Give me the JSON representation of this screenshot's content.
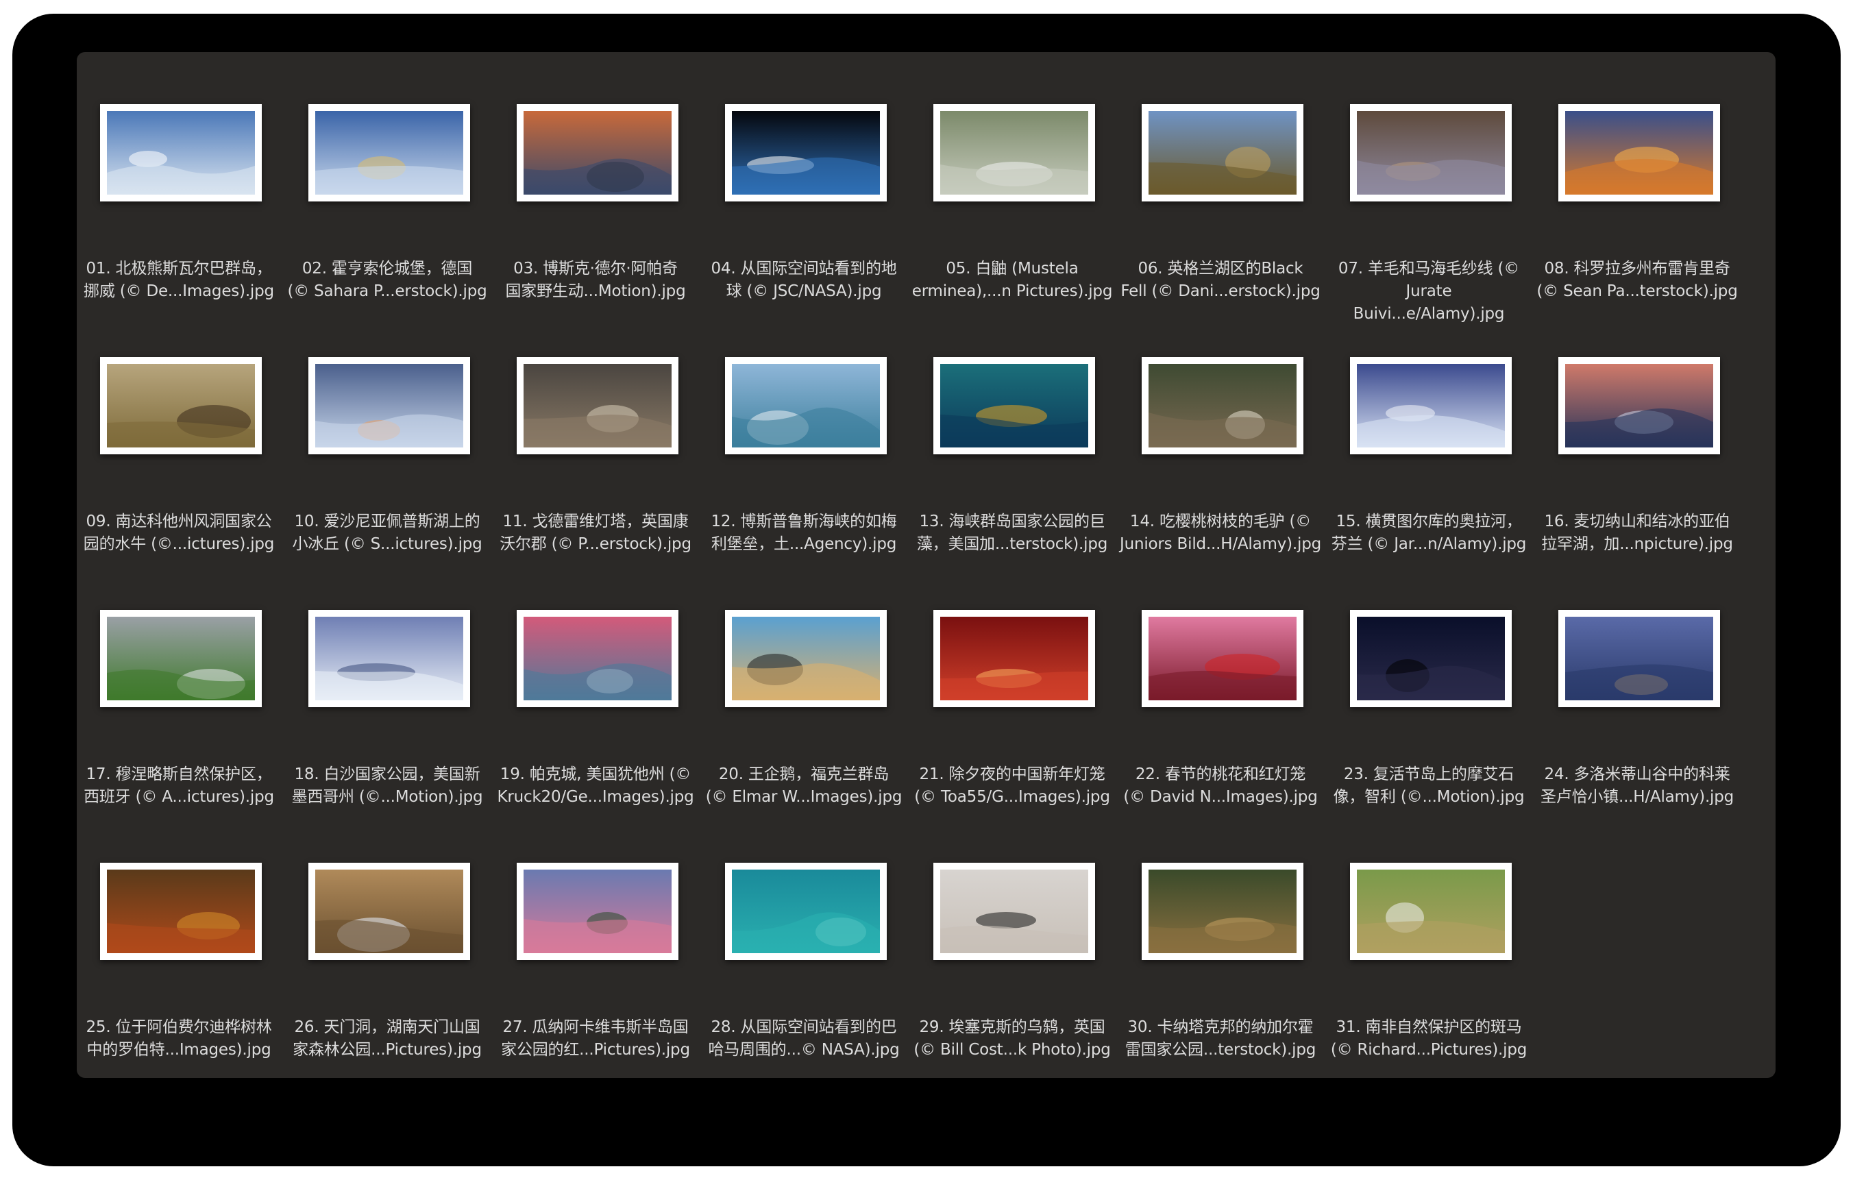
{
  "files": [
    {
      "name": "01. 北极熊斯瓦尔巴群岛，\n挪威 (© De...Images).jpg",
      "thumb": {
        "top": "#4b78b8",
        "bottom": "#d9e4f0",
        "accent": "#ffffff"
      }
    },
    {
      "name": "02. 霍亨索伦城堡，德国\n(© Sahara P...erstock).jpg",
      "thumb": {
        "top": "#3a64a8",
        "bottom": "#c9d8ec",
        "accent": "#e0c06a"
      }
    },
    {
      "name": "03. 博斯克·德尔·阿帕奇\n国家野生动...Motion).jpg",
      "thumb": {
        "top": "#c8693a",
        "bottom": "#3b4a6b",
        "accent": "#1d1d1d"
      }
    },
    {
      "name": "04. 从国际空间站看到的地\n球 (© JSC/NASA).jpg",
      "thumb": {
        "top": "#05070d",
        "bottom": "#2f6fb5",
        "accent": "#ffffff"
      }
    },
    {
      "name": "05. 白鼬 (Mustela\nerminea),...n Pictures).jpg",
      "thumb": {
        "top": "#7c8a6a",
        "bottom": "#c7ccbe",
        "accent": "#f2f2f2"
      }
    },
    {
      "name": "06. 英格兰湖区的Black\nFell (© Dani...erstock).jpg",
      "thumb": {
        "top": "#6f93c4",
        "bottom": "#6b5a2c",
        "accent": "#c4a35a"
      }
    },
    {
      "name": "07. 羊毛和马海毛纱线 (©\nJurate Buivi...e/Alamy).jpg",
      "thumb": {
        "top": "#5e4a3c",
        "bottom": "#8f8aa0",
        "accent": "#b89b80"
      }
    },
    {
      "name": "08. 科罗拉多州布雷肯里奇\n(© Sean Pa...terstock).jpg",
      "thumb": {
        "top": "#3a4f8a",
        "bottom": "#d77a2c",
        "accent": "#ffb347"
      }
    },
    {
      "name": "09. 南达科他州风洞国家公\n园的水牛 (©...ictures).jpg",
      "thumb": {
        "top": "#b7a57d",
        "bottom": "#7e6b3a",
        "accent": "#3b2a1a"
      }
    },
    {
      "name": "10. 爱沙尼亚佩普斯湖上的\n小冰丘 (© S...ictures).jpg",
      "thumb": {
        "top": "#4a5f8c",
        "bottom": "#c8d6ea",
        "accent": "#f0a060"
      }
    },
    {
      "name": "11. 戈德雷维灯塔，英国康\n沃尔郡 (© P...erstock).jpg",
      "thumb": {
        "top": "#4a4540",
        "bottom": "#8a7a66",
        "accent": "#d8cdb8"
      }
    },
    {
      "name": "12. 博斯普鲁斯海峡的如梅\n利堡垒，土...Agency).jpg",
      "thumb": {
        "top": "#8fb6d8",
        "bottom": "#3c7f9c",
        "accent": "#e9eef2"
      }
    },
    {
      "name": "13. 海峡群岛国家公园的巨\n藻，美国加...terstock).jpg",
      "thumb": {
        "top": "#1b6f7a",
        "bottom": "#0c3a5a",
        "accent": "#e0a020"
      }
    },
    {
      "name": "14. 吃樱桃树枝的毛驴 (©\nJuniors Bild...H/Alamy).jpg",
      "thumb": {
        "top": "#3e4a32",
        "bottom": "#7a6a52",
        "accent": "#e8e0d0"
      }
    },
    {
      "name": "15. 横贯图尔库的奥拉河，\n芬兰 (© Jar...n/Alamy).jpg",
      "thumb": {
        "top": "#3b4a8e",
        "bottom": "#d8e2f4",
        "accent": "#f2f4fa"
      }
    },
    {
      "name": "16. 麦切纳山和结冰的亚伯\n拉罕湖，加...npicture).jpg",
      "thumb": {
        "top": "#d07a6a",
        "bottom": "#27345a",
        "accent": "#c8d4ea"
      }
    },
    {
      "name": "17. 穆涅略斯自然保护区，\n西班牙 (© A...ictures).jpg",
      "thumb": {
        "top": "#9aa0a6",
        "bottom": "#3f7a2c",
        "accent": "#e8eaec"
      }
    },
    {
      "name": "18. 白沙国家公园，美国新\n墨西哥州 (©...Motion).jpg",
      "thumb": {
        "top": "#6f7fb4",
        "bottom": "#e8eef6",
        "accent": "#3a4a7a"
      }
    },
    {
      "name": "19. 帕克城, 美国犹他州 (©\nKruck20/Ge...Images).jpg",
      "thumb": {
        "top": "#d35a7a",
        "bottom": "#4f7a9a",
        "accent": "#eef2f6"
      }
    },
    {
      "name": "20. 王企鹅，福克兰群岛\n(© Elmar W...Images).jpg",
      "thumb": {
        "top": "#5aa0d0",
        "bottom": "#d8b070",
        "accent": "#1e1e1e"
      }
    },
    {
      "name": "21. 除夕夜的中国新年灯笼\n(© Toa55/G...Images).jpg",
      "thumb": {
        "top": "#7a1010",
        "bottom": "#d0402a",
        "accent": "#ffb060"
      }
    },
    {
      "name": "22. 春节的桃花和红灯笼\n(© David N...Images).jpg",
      "thumb": {
        "top": "#e07aa0",
        "bottom": "#7a1a2a",
        "accent": "#d02020"
      }
    },
    {
      "name": "23. 复活节岛上的摩艾石\n像，智利 (©...Motion).jpg",
      "thumb": {
        "top": "#0a0f2a",
        "bottom": "#2a2a4a",
        "accent": "#000000"
      }
    },
    {
      "name": "24. 多洛米蒂山谷中的科莱\n圣卢恰小镇...H/Alamy).jpg",
      "thumb": {
        "top": "#5a6aa8",
        "bottom": "#2a3a6a",
        "accent": "#f0c070"
      }
    },
    {
      "name": "25. 位于阿伯费尔迪桦树林\n中的罗伯特...Images).jpg",
      "thumb": {
        "top": "#5a3a1a",
        "bottom": "#b04a1a",
        "accent": "#d8902a"
      }
    },
    {
      "name": "26. 天门洞，湖南天门山国\n家森林公园...Pictures).jpg",
      "thumb": {
        "top": "#b08a5a",
        "bottom": "#6a5030",
        "accent": "#e8f0ff"
      }
    },
    {
      "name": "27. 瓜纳阿卡维韦斯半岛国\n家公园的红...Pictures).jpg",
      "thumb": {
        "top": "#6a7ab0",
        "bottom": "#d87a9a",
        "accent": "#2a4a2a"
      }
    },
    {
      "name": "28. 从国际空间站看到的巴\n哈马周围的...© NASA).jpg",
      "thumb": {
        "top": "#1a8a9a",
        "bottom": "#2ab0b0",
        "accent": "#8fe0d8"
      }
    },
    {
      "name": "29. 埃塞克斯的乌鸫，英国\n(© Bill Cost...k Photo).jpg",
      "thumb": {
        "top": "#d8d4d0",
        "bottom": "#c8c0b8",
        "accent": "#1a1a1a"
      }
    },
    {
      "name": "30. 卡纳塔克邦的纳加尔霍\n雷国家公园...terstock).jpg",
      "thumb": {
        "top": "#3a4a2a",
        "bottom": "#8a7040",
        "accent": "#c8a060"
      }
    },
    {
      "name": "31. 南非自然保护区的斑马\n(© Richard...Pictures).jpg",
      "thumb": {
        "top": "#7a9a4a",
        "bottom": "#b0a060",
        "accent": "#f0f0f0"
      }
    }
  ]
}
